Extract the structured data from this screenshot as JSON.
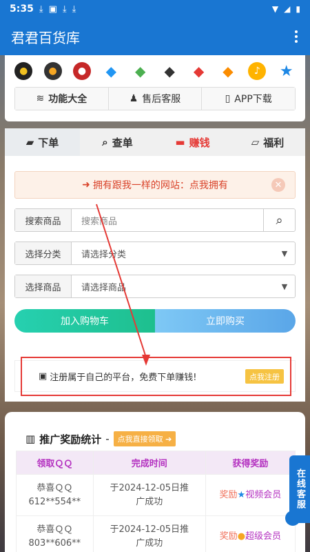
{
  "status": {
    "time": "5:35"
  },
  "app": {
    "title": "君君百货库"
  },
  "quick_links": [
    "功能大全",
    "售后客服",
    "APP下载"
  ],
  "tabs": [
    "下单",
    "查单",
    "赚钱",
    "福利"
  ],
  "promo": {
    "text": "拥有跟我一样的网站：点我拥有"
  },
  "search": {
    "label": "搜索商品",
    "placeholder": "搜索商品"
  },
  "category": {
    "label": "选择分类",
    "value": "请选择分类"
  },
  "product": {
    "label": "选择商品",
    "value": "请选择商品"
  },
  "actions": {
    "add_cart": "加入购物车",
    "buy_now": "立即购买"
  },
  "register": {
    "text": "注册属于自己的平台，免费下单赚钱!",
    "button": "点我注册"
  },
  "stats": {
    "title": "推广奖励统计",
    "sep": "-",
    "claim": "点我直接领取",
    "headers": [
      "领取ＱＱ",
      "完成时间",
      "获得奖励"
    ],
    "rows": [
      {
        "qq": "恭喜ＱＱ",
        "qq2": "612**554**",
        "time": "于2024-12-05日推",
        "time2": "广成功",
        "reward": "奖励",
        "level": "视频会员"
      },
      {
        "qq": "恭喜ＱＱ",
        "qq2": "803**606**",
        "time": "于2024-12-05日推",
        "time2": "广成功",
        "reward": "奖励",
        "level": "超级会员"
      }
    ]
  },
  "support": {
    "label": "在线客服"
  }
}
